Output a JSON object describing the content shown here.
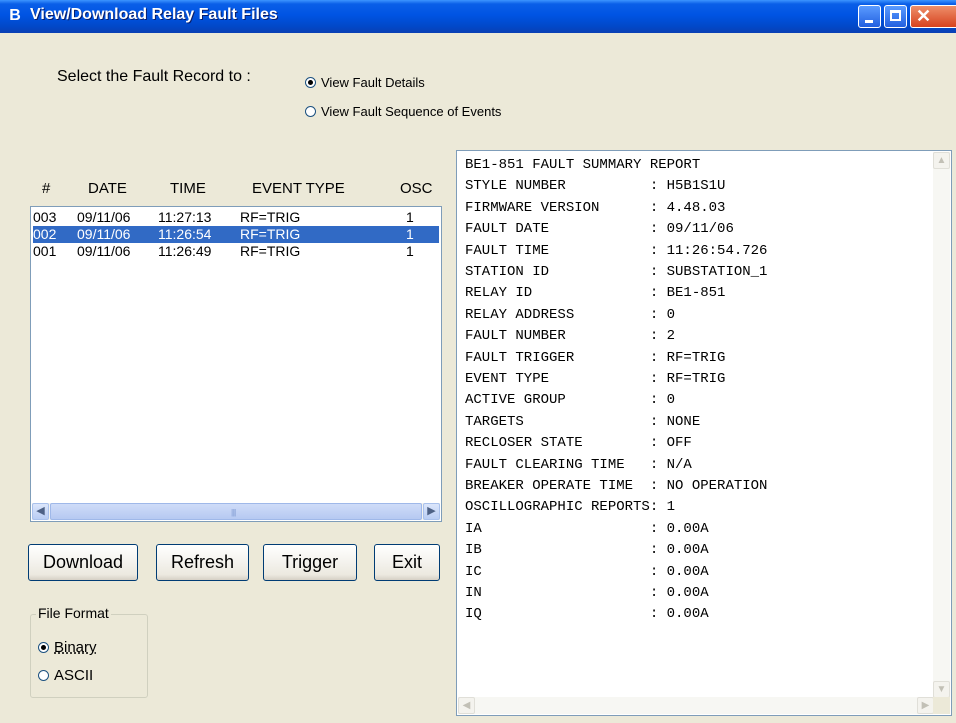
{
  "window": {
    "title": "View/Download Relay Fault Files",
    "app_icon": "relay-app-icon",
    "controls": {
      "minimize": "minimize-icon",
      "maximize": "maximize-icon",
      "close": "close-icon"
    }
  },
  "selector": {
    "label": "Select the Fault Record to :",
    "options": [
      {
        "label": "View Fault Details",
        "checked": true
      },
      {
        "label": "View Fault Sequence of Events",
        "checked": false
      }
    ]
  },
  "list": {
    "columns": [
      "#",
      "DATE",
      "TIME",
      "EVENT TYPE",
      "OSC"
    ],
    "rows": [
      {
        "num": "003",
        "date": "09/11/06",
        "time": "11:27:13",
        "type": "RF=TRIG",
        "osc": "1",
        "selected": false
      },
      {
        "num": "002",
        "date": "09/11/06",
        "time": "11:26:54",
        "type": "RF=TRIG",
        "osc": "1",
        "selected": true
      },
      {
        "num": "001",
        "date": "09/11/06",
        "time": "11:26:49",
        "type": "RF=TRIG",
        "osc": "1",
        "selected": false
      }
    ]
  },
  "buttons": {
    "download": "Download",
    "refresh": "Refresh",
    "trigger": "Trigger",
    "exit": "Exit"
  },
  "file_format": {
    "label": "File Format",
    "options": [
      {
        "label": "Binary",
        "checked": true
      },
      {
        "label": "ASCII",
        "checked": false
      }
    ]
  },
  "report": {
    "lines": [
      "BE1-851 FAULT SUMMARY REPORT",
      "STYLE NUMBER          : H5B1S1U",
      "FIRMWARE VERSION      : 4.48.03",
      "FAULT DATE            : 09/11/06",
      "FAULT TIME            : 11:26:54.726",
      "STATION ID            : SUBSTATION_1",
      "RELAY ID              : BE1-851",
      "RELAY ADDRESS         : 0",
      "FAULT NUMBER          : 2",
      "FAULT TRIGGER         : RF=TRIG",
      "EVENT TYPE            : RF=TRIG",
      "ACTIVE GROUP          : 0",
      "TARGETS               : NONE",
      "RECLOSER STATE        : OFF",
      "FAULT CLEARING TIME   : N/A",
      "BREAKER OPERATE TIME  : NO OPERATION",
      "OSCILLOGRAPHIC REPORTS: 1",
      "IA                    : 0.00A",
      "IB                    : 0.00A",
      "IC                    : 0.00A",
      "IN                    : 0.00A",
      "IQ                    : 0.00A"
    ]
  },
  "colors": {
    "titlebar": "#0054e3",
    "selection": "#316ac5",
    "dialog_bg": "#ece9d8"
  }
}
